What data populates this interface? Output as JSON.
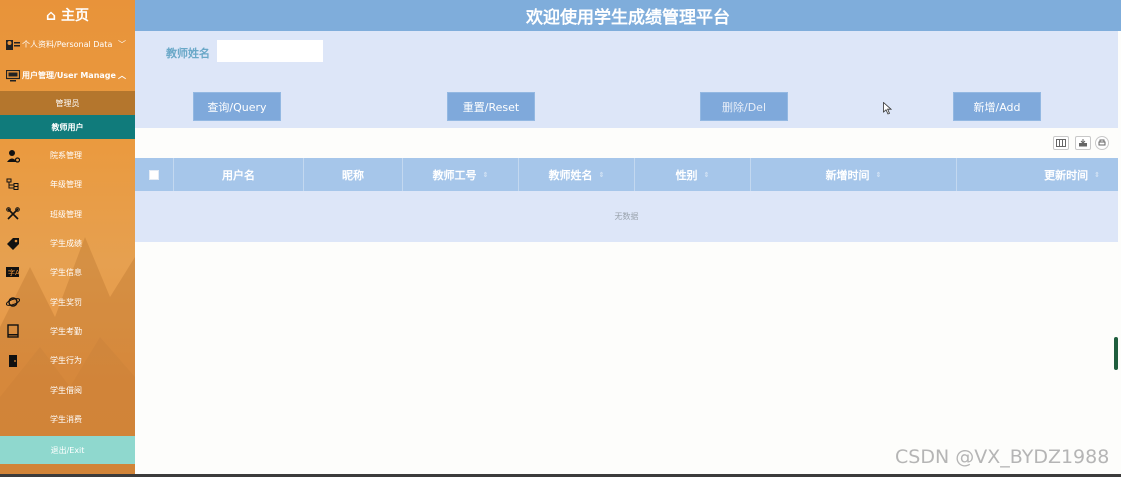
{
  "sidebar": {
    "home": "⌂ 主页",
    "groups": [
      {
        "label": "个人资料/Personal Data",
        "caret": "﹀"
      },
      {
        "label": "用户管理/User Manage",
        "caret": "︿"
      }
    ],
    "subs": [
      "管理员",
      "教师用户"
    ],
    "items": [
      {
        "label": "院系管理",
        "icon": "user-gear-icon"
      },
      {
        "label": "年级管理",
        "icon": "sitemap-icon"
      },
      {
        "label": "班级管理",
        "icon": "tools-icon"
      },
      {
        "label": "学生成绩",
        "icon": "tag-icon"
      },
      {
        "label": "学生信息",
        "icon": "translate-icon"
      },
      {
        "label": "学生奖罚",
        "icon": "planet-icon"
      },
      {
        "label": "学生考勤",
        "icon": "book-icon"
      },
      {
        "label": "学生行为",
        "icon": "door-icon"
      },
      {
        "label": "学生借阅",
        "icon": ""
      },
      {
        "label": "学生消费",
        "icon": ""
      }
    ],
    "exit": "退出/Exit",
    "colors": {
      "bg": "#e8933a",
      "active": "#107b7b",
      "exit": "#8fd8ce"
    }
  },
  "header": {
    "title": "欢迎使用学生成绩管理平台"
  },
  "search": {
    "label": "教师姓名",
    "value": "",
    "buttons": {
      "query": "查询/Query",
      "reset": "重置/Reset",
      "delete": "删除/Del",
      "add": "新增/Add"
    }
  },
  "table": {
    "columns": [
      "用户名",
      "昵称",
      "教师工号",
      "教师姓名",
      "性别",
      "新增时间",
      "更新时间"
    ],
    "empty_text": "无数据",
    "sort_glyph": "⇕"
  },
  "watermark": "CSDN @VX_BYDZ1988"
}
